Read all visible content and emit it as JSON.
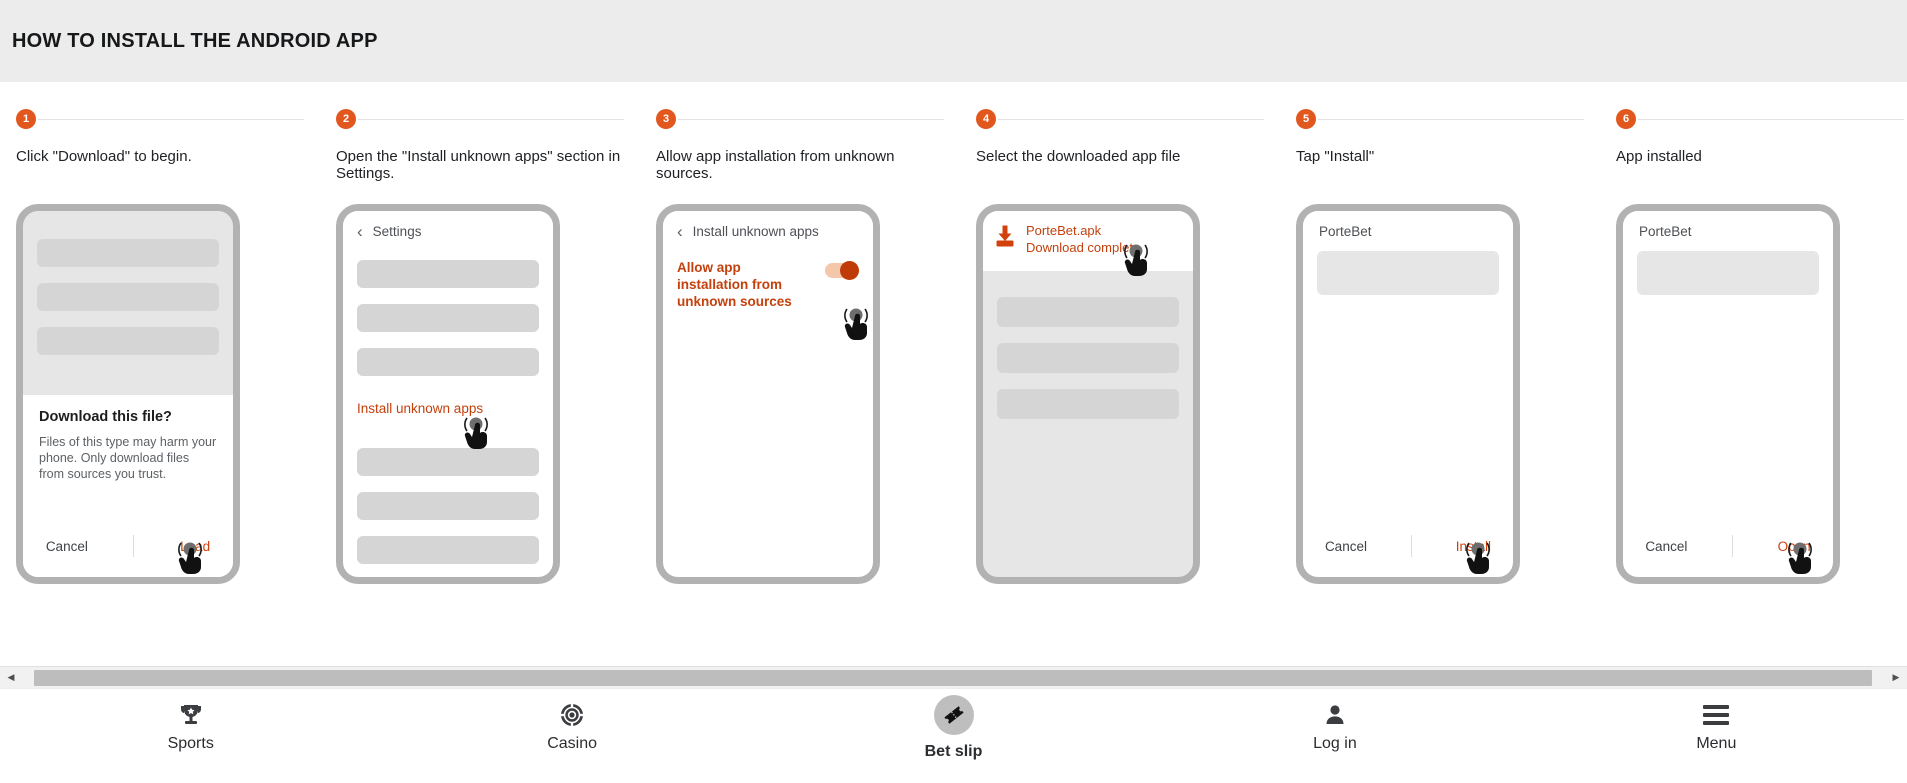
{
  "page": {
    "title": "HOW TO INSTALL THE ANDROID APP",
    "accent_color": "#e2571e",
    "link_color": "#c4400d"
  },
  "steps": [
    {
      "number": "1",
      "caption": "Click \"Download\" to begin.",
      "dialog": {
        "title": "Download this file?",
        "body": "Files of this type may harm your phone. Only download files from sources you trust.",
        "cancel_label": "Cancel",
        "primary_label": "Load"
      }
    },
    {
      "number": "2",
      "caption": "Open the \"Install unknown apps\" section in Settings.",
      "header_title": "Settings",
      "link_label": "Install unknown apps"
    },
    {
      "number": "3",
      "caption": "Allow app installation from unknown sources.",
      "header_title": "Install unknown apps",
      "toggle_label": "Allow app installation from unknown sources",
      "toggle_state": "on"
    },
    {
      "number": "4",
      "caption": "Select the downloaded app file",
      "file_name": "PorteBet.apk",
      "file_status": "Download complete"
    },
    {
      "number": "5",
      "caption": "Tap \"Install\"",
      "app_title": "PorteBet",
      "cancel_label": "Cancel",
      "primary_label": "Install"
    },
    {
      "number": "6",
      "caption": "App installed",
      "app_title": "PorteBet",
      "cancel_label": "Cancel",
      "primary_label": "Open"
    }
  ],
  "bottom_nav": {
    "items": [
      {
        "label": "Sports",
        "icon": "trophy-icon"
      },
      {
        "label": "Casino",
        "icon": "casino-chip-icon"
      },
      {
        "label": "Bet slip",
        "icon": "bet-slip-ticket-icon"
      },
      {
        "label": "Log in",
        "icon": "user-icon"
      },
      {
        "label": "Menu",
        "icon": "hamburger-menu-icon"
      }
    ]
  },
  "scrollbar": {
    "left_arrow": "◀",
    "right_arrow": "▶"
  }
}
